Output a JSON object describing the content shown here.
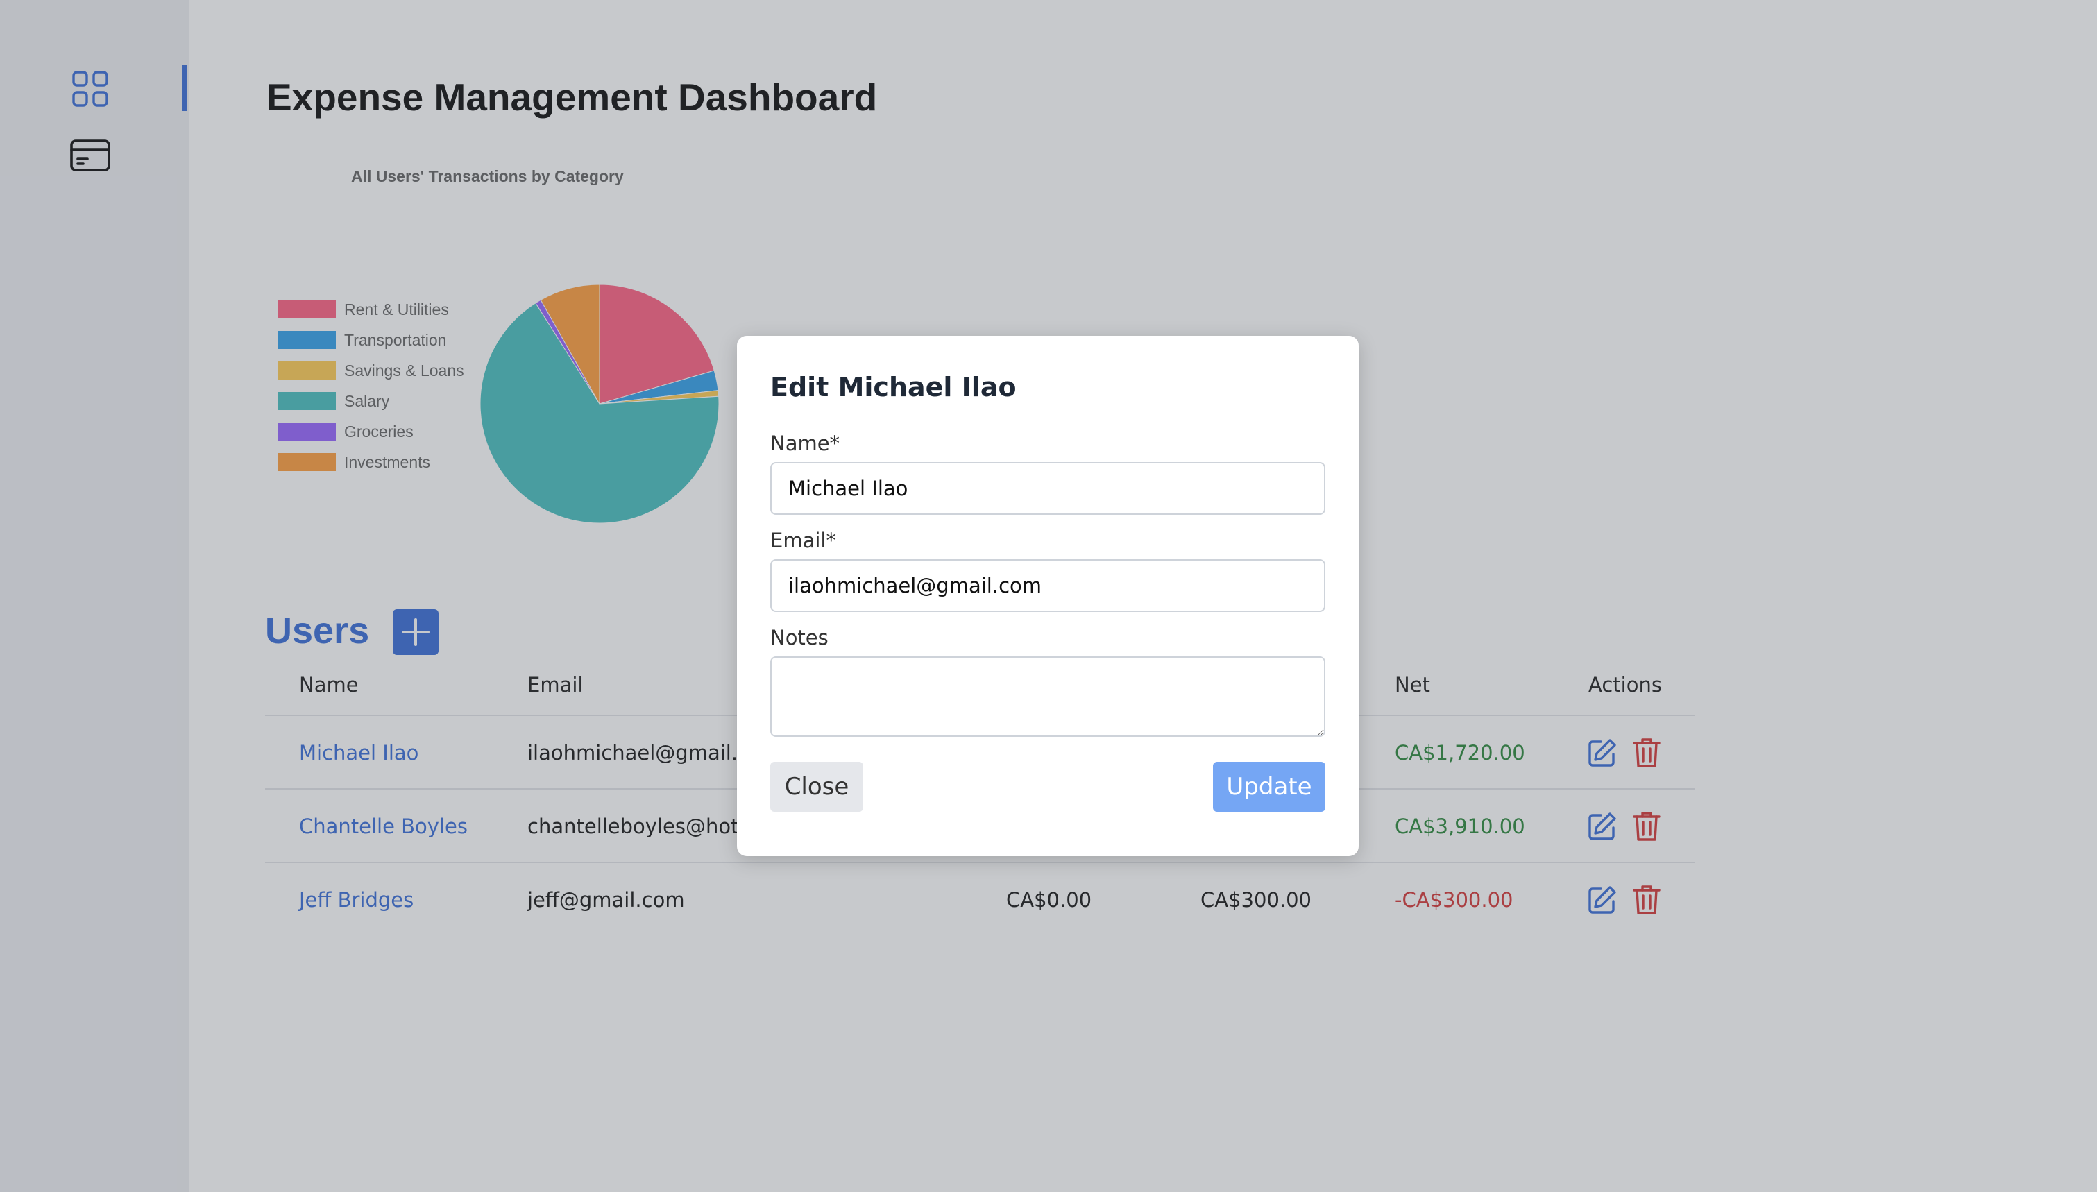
{
  "sidebar": {
    "items": [
      {
        "name": "dashboard",
        "icon": "grid-icon",
        "active": true
      },
      {
        "name": "transactions",
        "icon": "credit-card-icon",
        "active": false
      }
    ]
  },
  "header": {
    "title": "Expense Management Dashboard"
  },
  "chart_data": {
    "type": "pie",
    "title": "All Users' Transactions by Category",
    "legend_position": "left",
    "categories": [
      "Rent & Utilities",
      "Transportation",
      "Savings & Loans",
      "Salary",
      "Groceries",
      "Investments"
    ],
    "values": [
      20.5,
      2.7,
      0.8,
      67.0,
      0.8,
      8.2
    ],
    "colors": [
      "#ff6384",
      "#36a2eb",
      "#ffcd56",
      "#4bc0c0",
      "#9966ff",
      "#ff9f40"
    ]
  },
  "users": {
    "heading": "Users",
    "columns": [
      "Name",
      "Email",
      "",
      "",
      "Net",
      "Actions"
    ],
    "rows": [
      {
        "name": "Michael Ilao",
        "email": "ilaohmichael@gmail.c",
        "col3": "",
        "col4": "",
        "net": "CA$1,720.00",
        "net_sign": "pos"
      },
      {
        "name": "Chantelle Boyles",
        "email": "chantelleboyles@hotr",
        "col3": "",
        "col4": "",
        "net": "CA$3,910.00",
        "net_sign": "pos"
      },
      {
        "name": "Jeff Bridges",
        "email": "jeff@gmail.com",
        "col3": "CA$0.00",
        "col4": "CA$300.00",
        "net": "-CA$300.00",
        "net_sign": "neg"
      }
    ]
  },
  "modal": {
    "title": "Edit Michael Ilao",
    "name_label": "Name*",
    "name_value": "Michael Ilao",
    "email_label": "Email*",
    "email_value": "ilaohmichael@gmail.com",
    "notes_label": "Notes",
    "notes_value": "",
    "close_label": "Close",
    "update_label": "Update"
  },
  "colors": {
    "accent": "#3b6fd8",
    "positive": "#2e8a3e",
    "negative": "#d63a3a",
    "update_button": "#75a6f4"
  }
}
